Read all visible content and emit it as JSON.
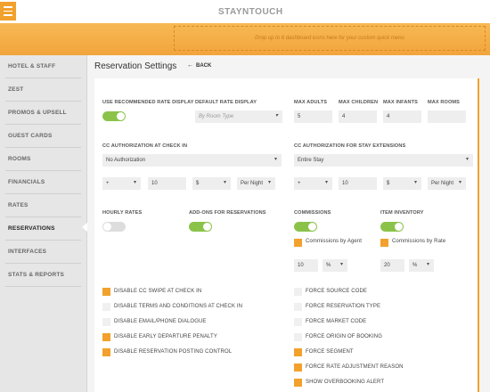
{
  "app": {
    "logo": "STAYNTOUCH"
  },
  "header": {
    "dropzone_text": "Drop up to 6 dashboard icons here for your custom quick menu"
  },
  "sidebar": {
    "items": [
      {
        "label": "HOTEL & STAFF"
      },
      {
        "label": "ZEST"
      },
      {
        "label": "PROMOS & UPSELL"
      },
      {
        "label": "GUEST CARDS"
      },
      {
        "label": "ROOMS"
      },
      {
        "label": "FINANCIALS"
      },
      {
        "label": "RATES"
      },
      {
        "label": "RESERVATIONS"
      },
      {
        "label": "INTERFACES"
      },
      {
        "label": "STATS & REPORTS"
      }
    ],
    "active": "RESERVATIONS"
  },
  "page": {
    "title": "Reservation Settings",
    "back_label": "BACK"
  },
  "settings": {
    "use_recommended_rate": {
      "label": "USE RECOMMENDED RATE DISPLAY",
      "on": true
    },
    "default_rate_display": {
      "label": "DEFAULT RATE DISPLAY",
      "value": "By Room Type"
    },
    "max_adults": {
      "label": "MAX ADULTS",
      "value": "5"
    },
    "max_children": {
      "label": "MAX CHILDREN",
      "value": "4"
    },
    "max_infants": {
      "label": "MAX INFANTS",
      "value": "4"
    },
    "max_rooms": {
      "label": "MAX ROOMS",
      "value": ""
    },
    "cc_auth_checkin": {
      "label": "CC AUTHORIZATION AT CHECK IN",
      "value": "No Authorization",
      "sign": "+",
      "amount": "10",
      "currency": "$",
      "period": "Per Night"
    },
    "cc_auth_extensions": {
      "label": "CC AUTHORIZATION FOR STAY EXTENSIONS",
      "value": "Entire Stay",
      "sign": "+",
      "amount": "10",
      "currency": "$",
      "period": "Per Night"
    },
    "hourly_rates": {
      "label": "HOURLY RATES",
      "on": false
    },
    "addons": {
      "label": "ADD-ONS FOR RESERVATIONS",
      "on": true
    },
    "commissions": {
      "label": "COMMISSIONS",
      "on": true,
      "by_agent_label": "Commissions by Agent",
      "by_agent": true,
      "value": "10",
      "unit": "%"
    },
    "item_inventory": {
      "label": "ITEM INVENTORY",
      "on": true,
      "by_rate_label": "Commissions by Rate",
      "by_rate": true,
      "value": "20",
      "unit": "%"
    }
  },
  "checkboxes_left": [
    {
      "label": "DISABLE CC SWIPE AT CHECK IN",
      "checked": true
    },
    {
      "label": "DISABLE TERMS AND CONDITIONS AT CHECK IN",
      "checked": false
    },
    {
      "label": "DISABLE EMAIL/PHONE DIALOGUE",
      "checked": false
    },
    {
      "label": "DISABLE EARLY DEPARTURE PENALTY",
      "checked": true
    },
    {
      "label": "DISABLE RESERVATION POSTING CONTROL",
      "checked": true
    }
  ],
  "checkboxes_right": [
    {
      "label": "FORCE SOURCE CODE",
      "checked": false
    },
    {
      "label": "FORCE RESERVATION TYPE",
      "checked": false
    },
    {
      "label": "FORCE MARKET CODE",
      "checked": false
    },
    {
      "label": "FORCE ORIGIN OF BOOKING",
      "checked": false
    },
    {
      "label": "FORCE SEGMENT",
      "checked": true
    },
    {
      "label": "FORCE RATE ADJUSTMENT REASON",
      "checked": true
    },
    {
      "label": "SHOW OVERBOOKING ALERT",
      "checked": true
    }
  ],
  "colors": {
    "accent": "#f2a12c",
    "toggle_on": "#8bc34a",
    "sidebar_bg": "#e6e6e6"
  }
}
